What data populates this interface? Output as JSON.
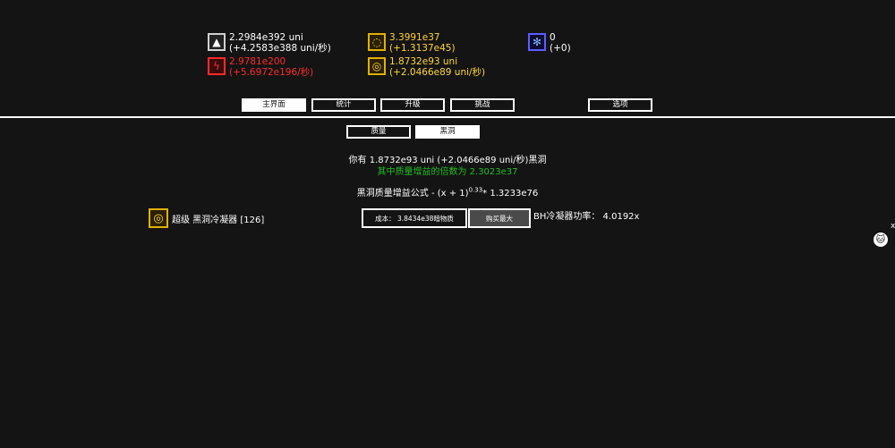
{
  "resources": {
    "mass": {
      "icon": "weight-icon",
      "amount": "2.2984e392 uni",
      "rate": "(+4.2583e388 uni/秒)",
      "color": "#ffffff"
    },
    "rage_power": {
      "icon": "lightning-icon",
      "amount": "2.9781e200",
      "rate": "(+5.6972e196/秒)",
      "color": "#ff2a2a"
    },
    "dark_matter": {
      "icon": "dark-matter-icon",
      "amount": "3.3991e37",
      "rate": "(+1.3137e45)",
      "color": "#ffd52e"
    },
    "black_hole": {
      "icon": "black-hole-icon",
      "amount": "1.8732e93 uni",
      "rate": "(+2.0466e89 uni/秒)",
      "color": "#ffd52e"
    },
    "atom": {
      "icon": "atom-icon",
      "amount": "0",
      "rate": "(+0)",
      "color": "#7fb2ff"
    }
  },
  "main_tabs": [
    {
      "label": "主界面",
      "active": true
    },
    {
      "label": "统计",
      "active": false
    },
    {
      "label": "升级",
      "active": false
    },
    {
      "label": "挑战",
      "active": false
    },
    {
      "label": "选项",
      "active": false
    }
  ],
  "sub_tabs": [
    {
      "label": "质量",
      "active": false
    },
    {
      "label": "黑洞",
      "active": true
    }
  ],
  "black_hole_panel": {
    "have_line": "你有 1.8732e93 uni (+2.0466e89 uni/秒)黑洞",
    "mass_boost_line": "其中质量增益的倍数为 2.3023e37",
    "formula_prefix": "黑洞质量增益公式 - (x + 1)",
    "formula_exponent": "0.33",
    "formula_suffix": "* 1.3233e76",
    "condenser": {
      "icon": "black-hole-icon",
      "label": "超级 黑洞冷凝器 [126]",
      "cost": "成本： 3.8434e38暗物质",
      "buy_max": "购买最大",
      "power": "BH冷凝器功率：  4.0192x"
    }
  },
  "side": {
    "close_glyph": "x",
    "icon": "cat-icon"
  }
}
